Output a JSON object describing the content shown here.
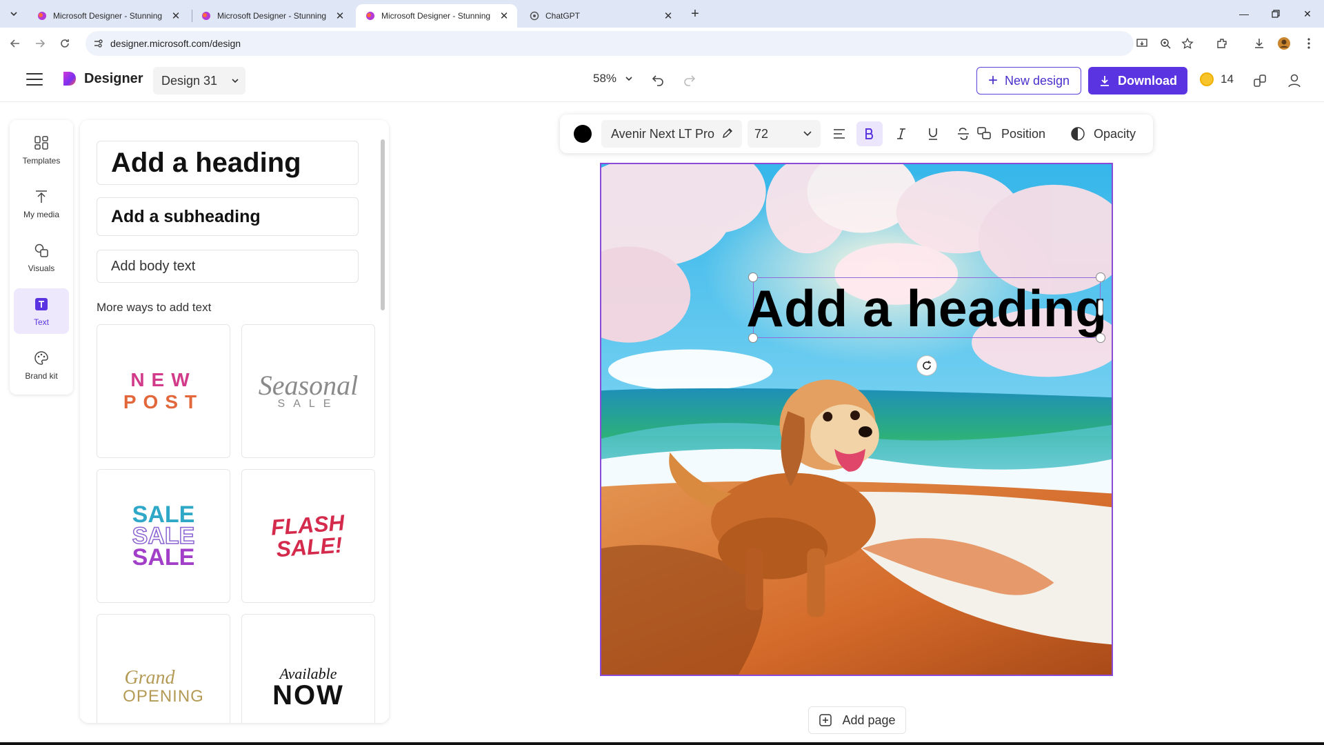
{
  "browser": {
    "tabs": [
      {
        "title": "Microsoft Designer - Stunning",
        "active": false
      },
      {
        "title": "Microsoft Designer - Stunning",
        "active": false
      },
      {
        "title": "Microsoft Designer - Stunning",
        "active": true
      },
      {
        "title": "ChatGPT",
        "active": false
      }
    ],
    "url": "designer.microsoft.com/design"
  },
  "header": {
    "brand": "Designer",
    "design_name": "Design 31",
    "zoom": "58%",
    "new_design_label": "New design",
    "download_label": "Download",
    "credits": "14",
    "colors": {
      "accent": "#5a34e0",
      "coin": "#f7c52b"
    }
  },
  "rail": {
    "items": [
      {
        "label": "Templates",
        "icon": "templates-icon"
      },
      {
        "label": "My media",
        "icon": "upload-icon"
      },
      {
        "label": "Visuals",
        "icon": "visuals-icon"
      },
      {
        "label": "Text",
        "icon": "text-icon",
        "active": true
      },
      {
        "label": "Brand kit",
        "icon": "palette-icon"
      }
    ]
  },
  "panel": {
    "heading_label": "Add a heading",
    "subheading_label": "Add a subheading",
    "body_label": "Add body text",
    "more_label": "More ways to add text",
    "tiles": [
      {
        "name": "new-post",
        "line1": "NEW",
        "line2": "POST"
      },
      {
        "name": "seasonal-sale",
        "line1": "Seasonal",
        "line2": "SALE"
      },
      {
        "name": "sale-sale-sale",
        "line1": "SALE",
        "line2": "SALE",
        "line3": "SALE"
      },
      {
        "name": "flash-sale",
        "line1": "FLASH",
        "line2": "SALE!"
      },
      {
        "name": "grand-opening",
        "line1": "Grand",
        "line2": "OPENING"
      },
      {
        "name": "available-now",
        "line1": "Available",
        "line2": "NOW"
      }
    ]
  },
  "format_bar": {
    "text_color": "#000000",
    "font": "Avenir Next LT Pro",
    "size": "72",
    "position_label": "Position",
    "opacity_label": "Opacity",
    "bold_active": true
  },
  "canvas": {
    "heading_text": "Add a heading",
    "add_page_label": "Add page"
  }
}
